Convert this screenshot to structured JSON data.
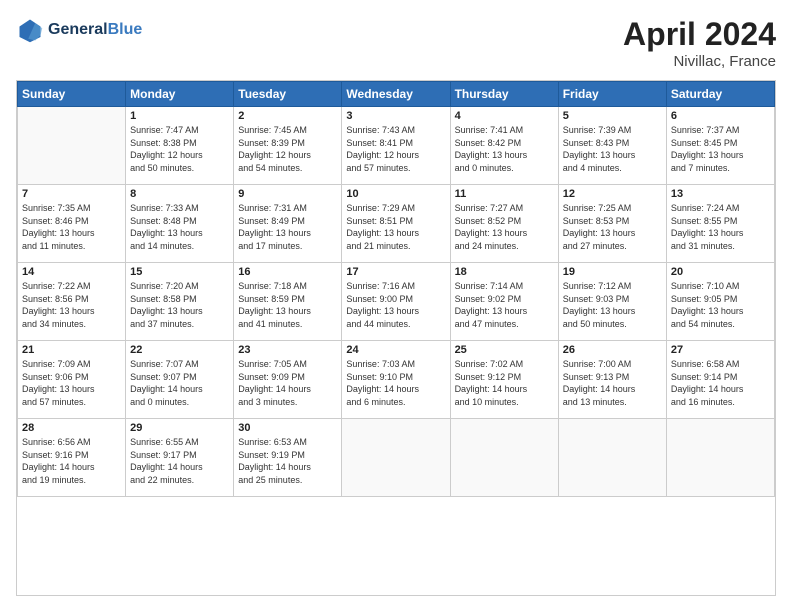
{
  "header": {
    "logo_line1": "General",
    "logo_line2": "Blue",
    "title": "April 2024",
    "subtitle": "Nivillac, France"
  },
  "calendar": {
    "days_of_week": [
      "Sunday",
      "Monday",
      "Tuesday",
      "Wednesday",
      "Thursday",
      "Friday",
      "Saturday"
    ],
    "weeks": [
      [
        {
          "day": "",
          "info": ""
        },
        {
          "day": "1",
          "info": "Sunrise: 7:47 AM\nSunset: 8:38 PM\nDaylight: 12 hours\nand 50 minutes."
        },
        {
          "day": "2",
          "info": "Sunrise: 7:45 AM\nSunset: 8:39 PM\nDaylight: 12 hours\nand 54 minutes."
        },
        {
          "day": "3",
          "info": "Sunrise: 7:43 AM\nSunset: 8:41 PM\nDaylight: 12 hours\nand 57 minutes."
        },
        {
          "day": "4",
          "info": "Sunrise: 7:41 AM\nSunset: 8:42 PM\nDaylight: 13 hours\nand 0 minutes."
        },
        {
          "day": "5",
          "info": "Sunrise: 7:39 AM\nSunset: 8:43 PM\nDaylight: 13 hours\nand 4 minutes."
        },
        {
          "day": "6",
          "info": "Sunrise: 7:37 AM\nSunset: 8:45 PM\nDaylight: 13 hours\nand 7 minutes."
        }
      ],
      [
        {
          "day": "7",
          "info": "Sunrise: 7:35 AM\nSunset: 8:46 PM\nDaylight: 13 hours\nand 11 minutes."
        },
        {
          "day": "8",
          "info": "Sunrise: 7:33 AM\nSunset: 8:48 PM\nDaylight: 13 hours\nand 14 minutes."
        },
        {
          "day": "9",
          "info": "Sunrise: 7:31 AM\nSunset: 8:49 PM\nDaylight: 13 hours\nand 17 minutes."
        },
        {
          "day": "10",
          "info": "Sunrise: 7:29 AM\nSunset: 8:51 PM\nDaylight: 13 hours\nand 21 minutes."
        },
        {
          "day": "11",
          "info": "Sunrise: 7:27 AM\nSunset: 8:52 PM\nDaylight: 13 hours\nand 24 minutes."
        },
        {
          "day": "12",
          "info": "Sunrise: 7:25 AM\nSunset: 8:53 PM\nDaylight: 13 hours\nand 27 minutes."
        },
        {
          "day": "13",
          "info": "Sunrise: 7:24 AM\nSunset: 8:55 PM\nDaylight: 13 hours\nand 31 minutes."
        }
      ],
      [
        {
          "day": "14",
          "info": "Sunrise: 7:22 AM\nSunset: 8:56 PM\nDaylight: 13 hours\nand 34 minutes."
        },
        {
          "day": "15",
          "info": "Sunrise: 7:20 AM\nSunset: 8:58 PM\nDaylight: 13 hours\nand 37 minutes."
        },
        {
          "day": "16",
          "info": "Sunrise: 7:18 AM\nSunset: 8:59 PM\nDaylight: 13 hours\nand 41 minutes."
        },
        {
          "day": "17",
          "info": "Sunrise: 7:16 AM\nSunset: 9:00 PM\nDaylight: 13 hours\nand 44 minutes."
        },
        {
          "day": "18",
          "info": "Sunrise: 7:14 AM\nSunset: 9:02 PM\nDaylight: 13 hours\nand 47 minutes."
        },
        {
          "day": "19",
          "info": "Sunrise: 7:12 AM\nSunset: 9:03 PM\nDaylight: 13 hours\nand 50 minutes."
        },
        {
          "day": "20",
          "info": "Sunrise: 7:10 AM\nSunset: 9:05 PM\nDaylight: 13 hours\nand 54 minutes."
        }
      ],
      [
        {
          "day": "21",
          "info": "Sunrise: 7:09 AM\nSunset: 9:06 PM\nDaylight: 13 hours\nand 57 minutes."
        },
        {
          "day": "22",
          "info": "Sunrise: 7:07 AM\nSunset: 9:07 PM\nDaylight: 14 hours\nand 0 minutes."
        },
        {
          "day": "23",
          "info": "Sunrise: 7:05 AM\nSunset: 9:09 PM\nDaylight: 14 hours\nand 3 minutes."
        },
        {
          "day": "24",
          "info": "Sunrise: 7:03 AM\nSunset: 9:10 PM\nDaylight: 14 hours\nand 6 minutes."
        },
        {
          "day": "25",
          "info": "Sunrise: 7:02 AM\nSunset: 9:12 PM\nDaylight: 14 hours\nand 10 minutes."
        },
        {
          "day": "26",
          "info": "Sunrise: 7:00 AM\nSunset: 9:13 PM\nDaylight: 14 hours\nand 13 minutes."
        },
        {
          "day": "27",
          "info": "Sunrise: 6:58 AM\nSunset: 9:14 PM\nDaylight: 14 hours\nand 16 minutes."
        }
      ],
      [
        {
          "day": "28",
          "info": "Sunrise: 6:56 AM\nSunset: 9:16 PM\nDaylight: 14 hours\nand 19 minutes."
        },
        {
          "day": "29",
          "info": "Sunrise: 6:55 AM\nSunset: 9:17 PM\nDaylight: 14 hours\nand 22 minutes."
        },
        {
          "day": "30",
          "info": "Sunrise: 6:53 AM\nSunset: 9:19 PM\nDaylight: 14 hours\nand 25 minutes."
        },
        {
          "day": "",
          "info": ""
        },
        {
          "day": "",
          "info": ""
        },
        {
          "day": "",
          "info": ""
        },
        {
          "day": "",
          "info": ""
        }
      ]
    ]
  }
}
